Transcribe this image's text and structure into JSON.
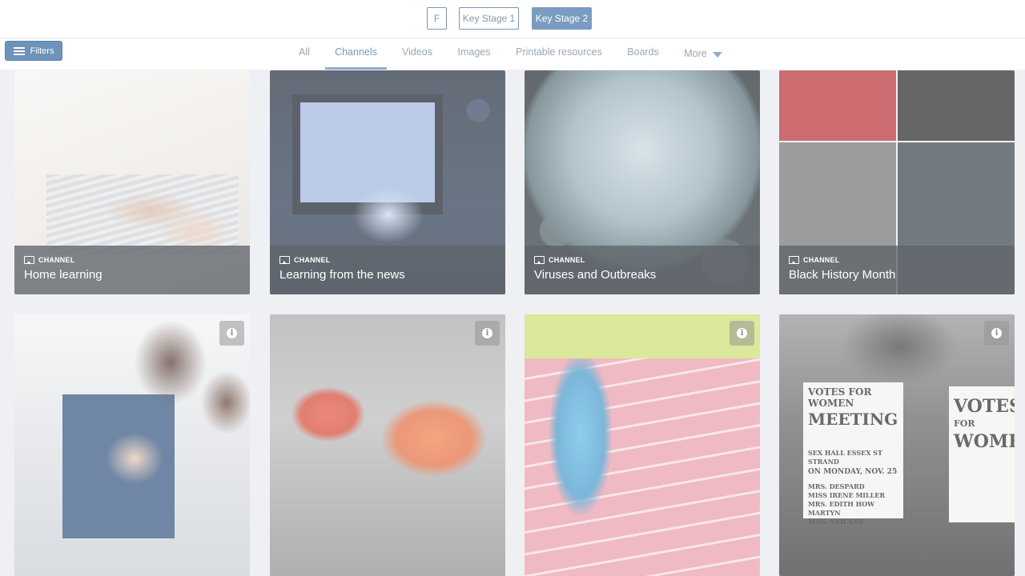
{
  "key_stages": {
    "f": "F",
    "ks1": "Key Stage 1",
    "ks2": "Key Stage 2"
  },
  "filters": {
    "label": "Filters"
  },
  "tabs": {
    "all": "All",
    "channels": "Channels",
    "videos": "Videos",
    "images": "Images",
    "printable": "Printable resources",
    "boards": "Boards",
    "more": "More"
  },
  "channels": [
    {
      "type": "CHANNEL",
      "title": "Home learning"
    },
    {
      "type": "CHANNEL",
      "title": "Learning from the news"
    },
    {
      "type": "CHANNEL",
      "title": "Viruses and Outbreaks"
    },
    {
      "type": "CHANNEL",
      "title": "Black History Month"
    }
  ],
  "info_glyph": "i",
  "poster": {
    "line1": "VOTES FOR WOMEN",
    "line2": "MEETING",
    "line3": "SEX HALL ESSEX ST STRAND",
    "line4": "ON MONDAY, NOV. 25",
    "line5": "MRS. DESPARD",
    "line6": "MISS IRENE MILLER",
    "line7": "MRS. EDITH HOW MARTYN",
    "line8": "MISS NEILANS",
    "side1": "VOTES",
    "side2": "FOR",
    "side3": "WOMEN"
  },
  "colors": {
    "accent": "#7a9cc0",
    "filters_bg": "#6e93b9",
    "tab_text": "#9aa7b3",
    "tab_active_underline": "#8eb0cf"
  }
}
